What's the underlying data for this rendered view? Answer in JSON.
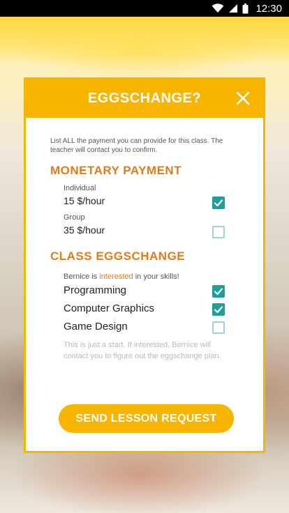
{
  "status_bar": {
    "time": "12:30",
    "icons": [
      "wifi-icon",
      "signal-icon",
      "battery-icon"
    ]
  },
  "dialog": {
    "title": "EGGSCHANGE?",
    "close_icon": "close-icon",
    "intro": "List ALL the payment you can provide for this class. The teacher will contact you to confirm.",
    "monetary": {
      "title": "MONETARY PAYMENT",
      "options": [
        {
          "label": "Individual",
          "price": "15 $/hour",
          "checked": true
        },
        {
          "label": "Group",
          "price": "35 $/hour",
          "checked": false
        }
      ]
    },
    "eggschange": {
      "title": "CLASS EGGSCHANGE",
      "interest_prefix": "Bernice is ",
      "interest_highlight": "interested",
      "interest_suffix": " in your skills!",
      "skills": [
        {
          "label": "Programming",
          "checked": true
        },
        {
          "label": "Computer Graphics",
          "checked": true
        },
        {
          "label": "Game Design",
          "checked": false
        }
      ],
      "note": "This is just a start. If interested, Bernice will contact you to figure out the eggschange plan."
    },
    "send_button": "SEND LESSON REQUEST"
  },
  "colors": {
    "accent": "#f7b500",
    "section_title": "#e07b17",
    "checkbox": "#1f9e9a"
  }
}
